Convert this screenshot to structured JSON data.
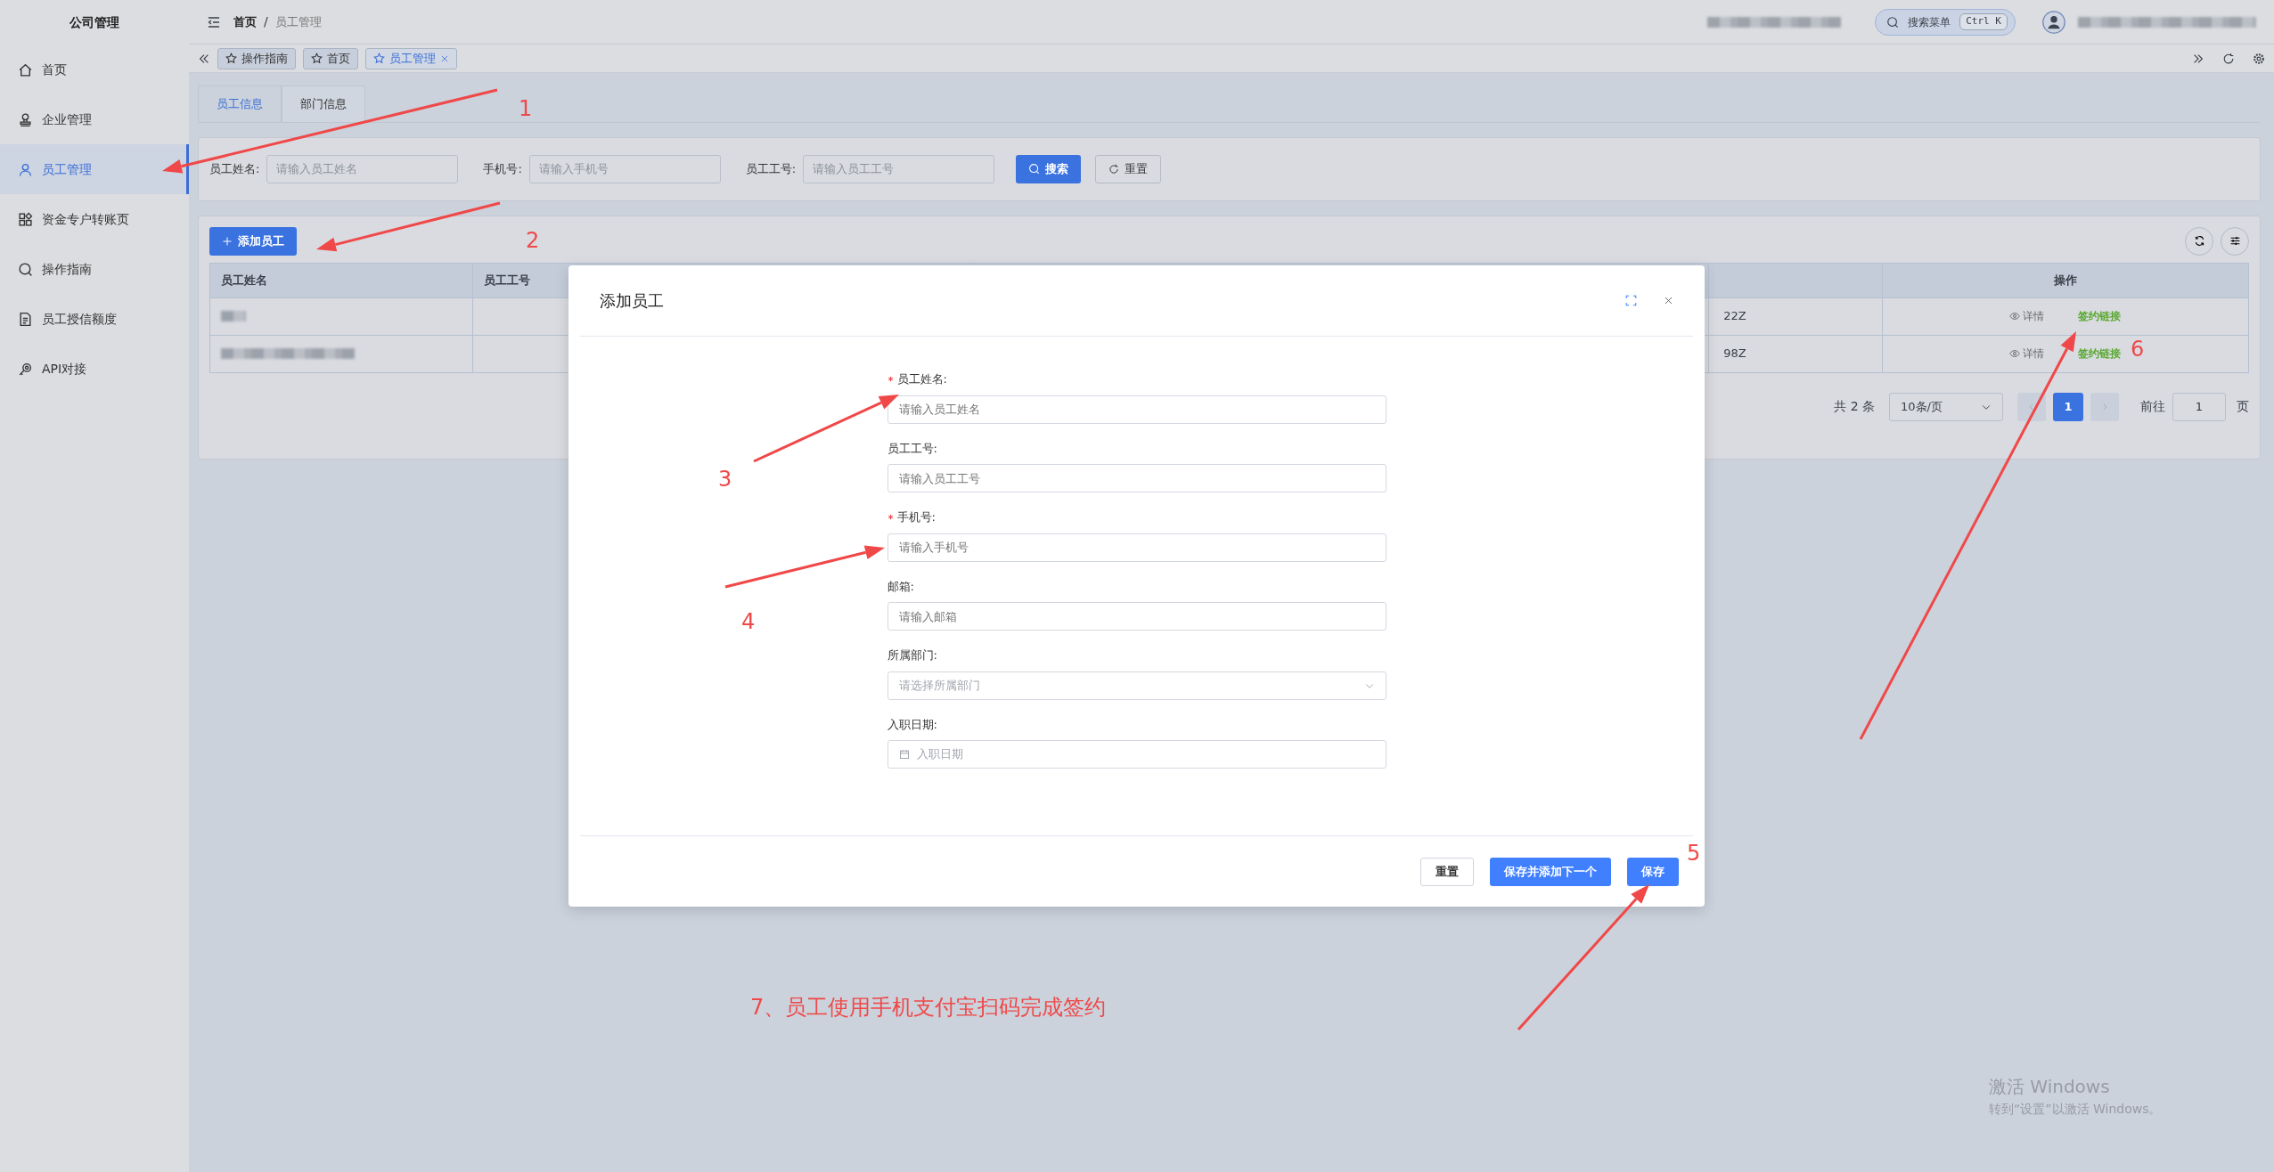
{
  "sidebar": {
    "title": "公司管理",
    "items": [
      {
        "label": "首页",
        "selected": false
      },
      {
        "label": "企业管理",
        "selected": false
      },
      {
        "label": "员工管理",
        "selected": true
      },
      {
        "label": "资金专户转账页",
        "selected": false
      },
      {
        "label": "操作指南",
        "selected": false
      },
      {
        "label": "员工授信额度",
        "selected": false
      },
      {
        "label": "API对接",
        "selected": false
      }
    ]
  },
  "header": {
    "breadcrumb": [
      "首页",
      "员工管理"
    ],
    "breadcrumb_separator": "/",
    "search": {
      "label": "搜索菜单",
      "shortcut": "Ctrl K"
    }
  },
  "page_tabs": [
    {
      "label": "操作指南",
      "selected": false,
      "closable": false
    },
    {
      "label": "首页",
      "selected": false,
      "closable": false
    },
    {
      "label": "员工管理",
      "selected": true,
      "closable": true
    }
  ],
  "sub_tabs": [
    {
      "label": "员工信息",
      "selected": true
    },
    {
      "label": "部门信息",
      "selected": false
    }
  ],
  "filters": [
    {
      "label": "员工姓名:",
      "placeholder": "请输入员工姓名"
    },
    {
      "label": "手机号:",
      "placeholder": "请输入手机号"
    },
    {
      "label": "员工工号:",
      "placeholder": "请输入员工工号"
    }
  ],
  "search_button": "搜索",
  "reset_button": "重置",
  "add_button": "添加员工",
  "table": {
    "columns": [
      "员工姓名",
      "员工工号",
      "",
      "",
      "操作"
    ],
    "rows": [
      {
        "column_4": "22Z",
        "actions": [
          "详情",
          "签约链接"
        ]
      },
      {
        "column_4": "98Z",
        "actions": [
          "详情",
          "签约链接"
        ]
      }
    ]
  },
  "pagination": {
    "total": "共 2 条",
    "page_size": "10条/页",
    "pages": [
      {
        "label": "1",
        "selected": true
      }
    ],
    "goto_label": "前往",
    "goto_value": "1",
    "suffix": "页"
  },
  "modal": {
    "title": "添加员工",
    "fields": [
      {
        "kind": "text",
        "label": "员工姓名:",
        "required": true,
        "placeholder": "请输入员工姓名"
      },
      {
        "kind": "text",
        "label": "员工工号:",
        "required": false,
        "placeholder": "请输入员工工号"
      },
      {
        "kind": "text",
        "label": "手机号:",
        "required": true,
        "placeholder": "请输入手机号"
      },
      {
        "kind": "text",
        "label": "邮箱:",
        "required": false,
        "placeholder": "请输入邮箱"
      },
      {
        "kind": "select",
        "label": "所属部门:",
        "required": false,
        "placeholder": "请选择所属部门"
      },
      {
        "kind": "date",
        "label": "入职日期:",
        "required": false,
        "placeholder": "入职日期"
      }
    ],
    "buttons": [
      {
        "label": "重置",
        "kind": "default"
      },
      {
        "label": "保存并添加下一个",
        "kind": "primary"
      },
      {
        "label": "保存",
        "kind": "primary"
      }
    ]
  },
  "annotations": {
    "markers": [
      "1",
      "2",
      "3",
      "4",
      "5",
      "6"
    ],
    "note": "7、员工使用手机支付宝扫码完成签约"
  },
  "os_notice": {
    "title": "激活 Windows",
    "subtitle": "转到“设置”以激活 Windows。"
  }
}
